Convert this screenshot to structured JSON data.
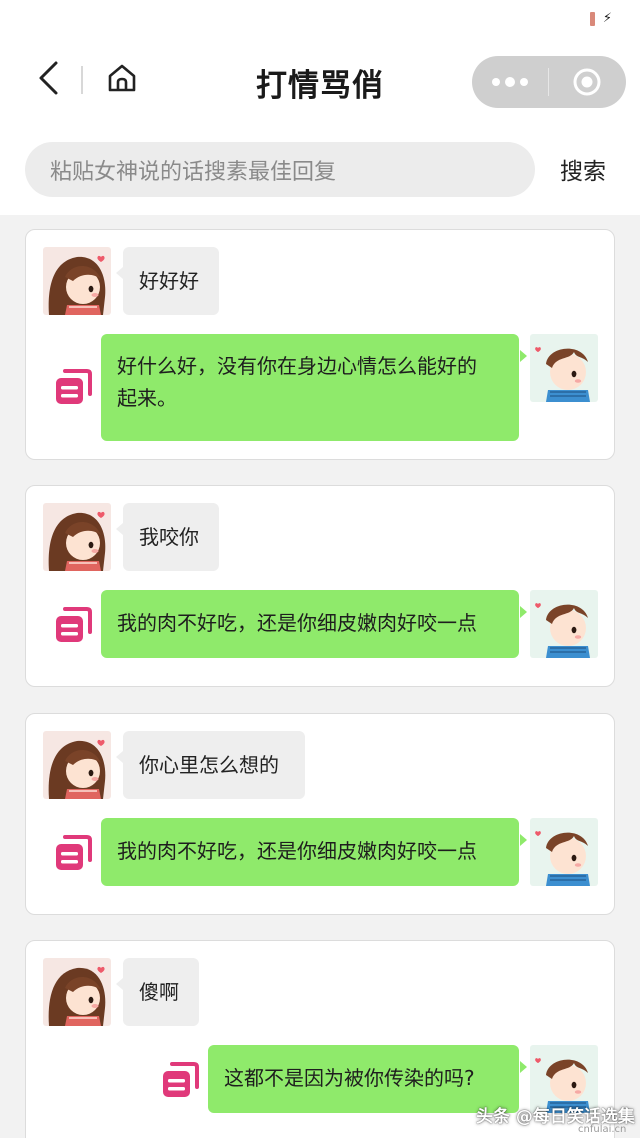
{
  "header": {
    "title": "打情骂俏",
    "back_icon": "chevron-left-icon",
    "home_icon": "home-icon",
    "more_icon": "more-dots-icon",
    "close_icon": "target-close-icon"
  },
  "search": {
    "placeholder": "粘贴女神说的话搜素最佳回复",
    "button_label": "搜索"
  },
  "conversations": [
    {
      "her": "好好好",
      "reply_line1": "好什么好，没有你在身边心情怎么能好的",
      "reply_line2": "起来。"
    },
    {
      "her": "我咬你",
      "reply": "我的肉不好吃，还是你细皮嫩肉好咬一点"
    },
    {
      "her": "你心里怎么想的",
      "reply": "我的肉不好吃，还是你细皮嫩肉好咬一点"
    },
    {
      "her": "傻啊",
      "reply": "这都不是因为被你传染的吗?"
    }
  ],
  "watermark": {
    "text": "头条 @每日笑话选集",
    "sub": "cnfulai.cn"
  },
  "colors": {
    "reply_bubble": "#8fea6b",
    "message_bubble": "#eeeeee",
    "copy_icon": "#e0397a"
  }
}
